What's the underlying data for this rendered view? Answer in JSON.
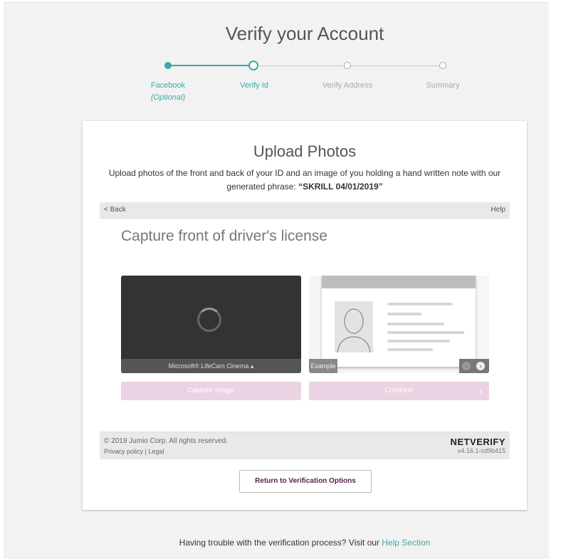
{
  "page": {
    "title": "Verify your Account"
  },
  "stepper": {
    "steps": [
      {
        "label": "Facebook",
        "sub": "(Optional)",
        "state": "done"
      },
      {
        "label": "Verify Id",
        "state": "current"
      },
      {
        "label": "Verify Address",
        "state": "pending"
      },
      {
        "label": "Summary",
        "state": "pending"
      }
    ]
  },
  "card": {
    "title": "Upload Photos",
    "desc_part1": "Upload photos of the front and back of your ID and an image of you holding a hand written note with our generated phrase: ",
    "desc_phrase": "“SKRILL 04/01/2019”"
  },
  "widget": {
    "back_label": "< Back",
    "help_label": "Help",
    "capture_title": "Capture front of driver's license",
    "camera_name": "Microsoft® LifeCam Cinema ▴",
    "example_tag": "Example",
    "capture_button": "Capture Image",
    "continue_button": "Continue",
    "continue_chevron": "›",
    "footer_copyright": "© 2019 Jumio Corp. All rights reserved.",
    "footer_privacy": "Privacy policy",
    "footer_sep": " | ",
    "footer_legal": "Legal",
    "brand": "NETVERIFY",
    "version": "v4.16.1-cd9b415"
  },
  "actions": {
    "return_button": "Return to Verification Options"
  },
  "footer": {
    "trouble_text": "Having trouble with the verification process? Visit our ",
    "help_link": "Help Section"
  },
  "colors": {
    "accent": "#3fa7a8",
    "pink_button": "#ead3e2",
    "return_text": "#5a1e4a"
  }
}
